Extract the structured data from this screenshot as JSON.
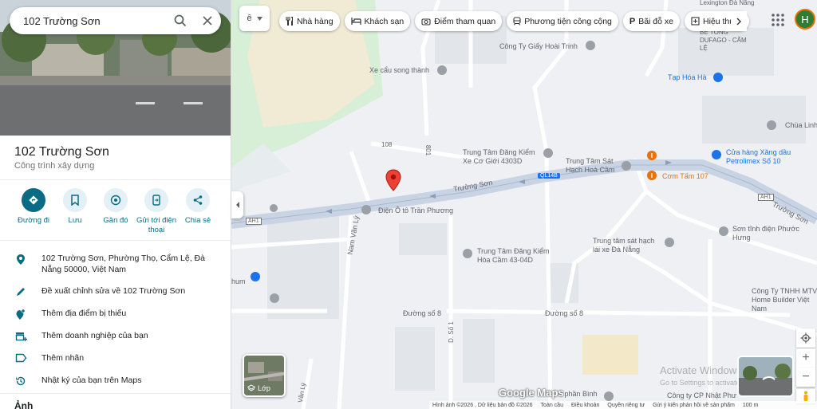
{
  "search": {
    "query": "102 Trường Sơn"
  },
  "place": {
    "name": "102 Trường Sơn",
    "category": "Công trình xây dựng"
  },
  "actions": [
    {
      "label": "Đường đi",
      "icon": "directions-icon"
    },
    {
      "label": "Lưu",
      "icon": "bookmark-icon"
    },
    {
      "label": "Gần đó",
      "icon": "nearby-icon"
    },
    {
      "label": "Gửi tới điện thoại",
      "icon": "send-to-phone-icon"
    },
    {
      "label": "Chia sẻ",
      "icon": "share-icon"
    }
  ],
  "info_rows": [
    {
      "text": "102 Trường Sơn, Phường Thọ, Cẩm Lệ, Đà Nẵng 50000, Việt Nam",
      "icon": "location-pin-icon"
    },
    {
      "text": "Đề xuất chỉnh sửa về 102 Trường Sơn",
      "icon": "edit-pencil-icon"
    },
    {
      "text": "Thêm địa điểm bị thiếu",
      "icon": "add-place-icon"
    },
    {
      "text": "Thêm doanh nghiệp của bạn",
      "icon": "add-business-icon"
    },
    {
      "text": "Thêm nhãn",
      "icon": "label-icon"
    },
    {
      "text": "Nhật ký của bạn trên Maps",
      "icon": "history-icon"
    }
  ],
  "photos_heading": "Ảnh",
  "chips": [
    {
      "label": "Nhà hàng",
      "icon": "restaurant-icon"
    },
    {
      "label": "Khách sạn",
      "icon": "hotel-icon"
    },
    {
      "label": "Điểm tham quan",
      "icon": "camera-icon"
    },
    {
      "label": "Phương tiện công cộng",
      "icon": "transit-icon"
    },
    {
      "label": "Bãi đỗ xe",
      "icon": "parking-icon"
    },
    {
      "label": "Hiệu thuốc",
      "icon": "pharmacy-icon"
    }
  ],
  "map_labels": {
    "betong": "BÊ TÔNG DUFAGO - CẨM LỆ",
    "lexington": "Lexington Đà Nẵng",
    "giay": "Công Ty Giấy Hoài Trinh",
    "xecau": "Xe cẩu song thành",
    "taphoa": "Tạp Hóa Hà",
    "chualinh": "Chùa Linh",
    "road108": "108",
    "road801": "801",
    "dangkiem1": "Trung Tâm Đăng Kiểm Xe Cơ Giới 4303D",
    "sathach1": "Trung Tâm Sát Hạch Hoà Cầm",
    "xangdau": "Cửa hàng Xăng dầu Petrolimex Số 10",
    "comtam": "Cơm Tấm 107",
    "ql14b": "QL14B",
    "ah1a": "AH1",
    "ah1b": "AH1",
    "truongson1": "Trường Sơn",
    "truongson2": "Trường Sơn",
    "dienoto": "Điện Ô tô Trần Phương",
    "namvanly": "Nam Văn Lý",
    "dangkiem2": "Trung Tâm Đăng Kiểm Hòa Cầm 43-04D",
    "sathach2": "Trung tâm sát hạch lái xe Đà Nẵng",
    "sonphuochung": "Sơn tĩnh điện Phước Hưng",
    "homebuilder": "Công Ty TNHH MTV Home Builder Việt Nam",
    "hum": "hum",
    "duongso8a": "Đường số 8",
    "duongso8b": "Đường số 8",
    "ds1": "D. Số 1",
    "vanly": "Văn Lý",
    "phanbinh": "ô phần Bình",
    "nhatphu": "Công ty CP Nhật Phư"
  },
  "layers_label": "Lớp",
  "watermark": {
    "line1": "Activate Windows",
    "line2": "Go to Settings to activate Windows."
  },
  "google_logo": "Google Maps",
  "footer": [
    "Hình ảnh ©2026 , Dữ liệu bản đồ ©2026",
    "Toàn cầu",
    "Điều khoản",
    "Quyền riêng tư",
    "Gửi ý kiến phản hồi về sản phẩm",
    "100 m"
  ],
  "avatar_letter": "H",
  "colors": {
    "accent": "#0a6b84",
    "map_road": "#c8d3e3",
    "pin": "#ea4335",
    "water": "#aadaff",
    "park": "#d2ebd4",
    "sand": "#f1ead4"
  }
}
